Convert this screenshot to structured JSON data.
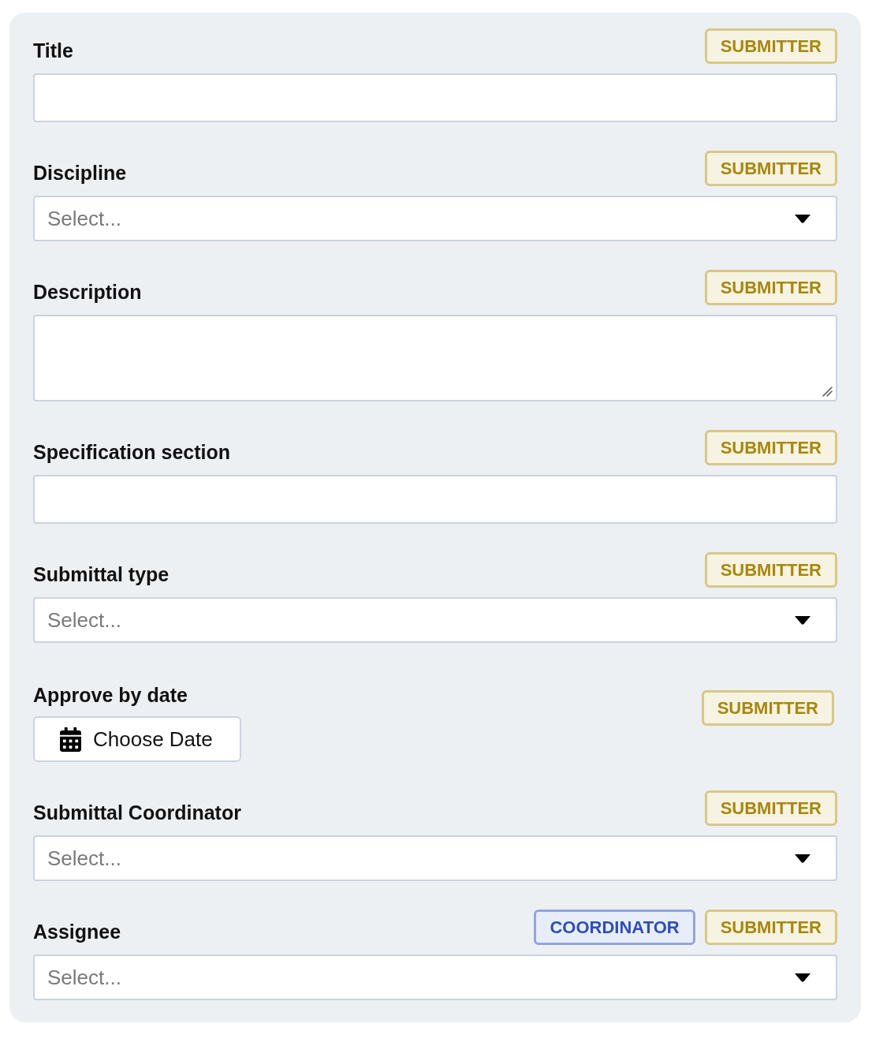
{
  "form": {
    "fields": [
      {
        "kind": "text",
        "label": "Title",
        "badges": [
          {
            "kind": "submitter",
            "text": "SUBMITTER"
          }
        ]
      },
      {
        "kind": "select",
        "label": "Discipline",
        "placeholder": "Select...",
        "badges": [
          {
            "kind": "submitter",
            "text": "SUBMITTER"
          }
        ]
      },
      {
        "kind": "textarea",
        "label": "Description",
        "badges": [
          {
            "kind": "submitter",
            "text": "SUBMITTER"
          }
        ]
      },
      {
        "kind": "text",
        "label": "Specification section",
        "badges": [
          {
            "kind": "submitter",
            "text": "SUBMITTER"
          }
        ]
      },
      {
        "kind": "select",
        "label": "Submittal type",
        "placeholder": "Select...",
        "badges": [
          {
            "kind": "submitter",
            "text": "SUBMITTER"
          }
        ]
      },
      {
        "kind": "date",
        "label": "Approve by date",
        "button": "Choose Date",
        "badges": [
          {
            "kind": "submitter",
            "text": "SUBMITTER"
          }
        ]
      },
      {
        "kind": "select",
        "label": "Submittal Coordinator",
        "placeholder": "Select...",
        "badges": [
          {
            "kind": "submitter",
            "text": "SUBMITTER"
          }
        ]
      },
      {
        "kind": "select",
        "label": "Assignee",
        "placeholder": "Select...",
        "badges": [
          {
            "kind": "coordinator",
            "text": "COORDINATOR"
          },
          {
            "kind": "submitter",
            "text": "SUBMITTER"
          }
        ]
      }
    ]
  }
}
